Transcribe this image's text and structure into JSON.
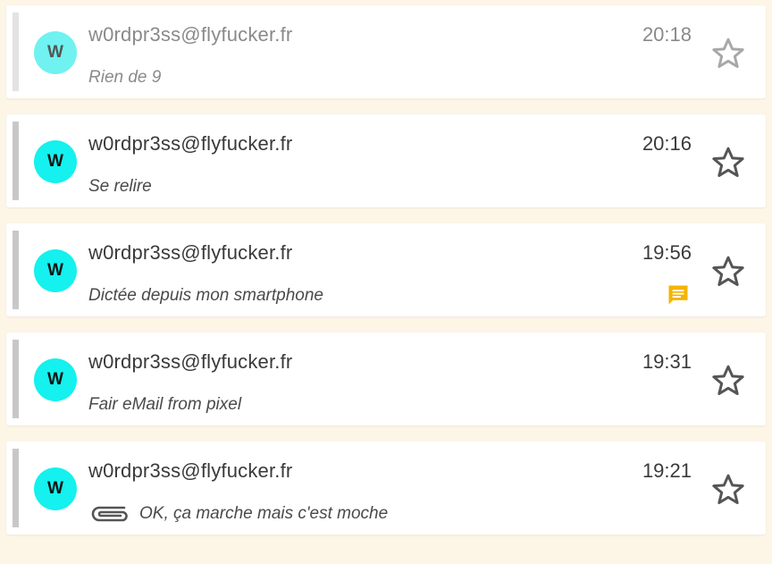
{
  "messages": [
    {
      "sender": "w0rdpr3ss@flyfucker.fr",
      "time": "20:18",
      "subject": "Rien de 9",
      "avatar": "W",
      "read": true
    },
    {
      "sender": "w0rdpr3ss@flyfucker.fr",
      "time": "20:16",
      "subject": "Se relire",
      "avatar": "W",
      "read": false
    },
    {
      "sender": "w0rdpr3ss@flyfucker.fr",
      "time": "19:56",
      "subject": "Dictée depuis mon smartphone",
      "avatar": "W",
      "read": false,
      "icon": "chat-icon"
    },
    {
      "sender": "w0rdpr3ss@flyfucker.fr",
      "time": "19:31",
      "subject": "Fair eMail from pixel",
      "avatar": "W",
      "read": false
    },
    {
      "sender": "w0rdpr3ss@flyfucker.fr",
      "time": "19:21",
      "subject": "OK, ça marche mais c'est moche",
      "avatar": "W",
      "read": false,
      "icon": "attachment-icon"
    }
  ],
  "colors": {
    "avatar": "#14f1ee",
    "chat_icon": "#f5b400",
    "background": "#fdf5e6"
  }
}
